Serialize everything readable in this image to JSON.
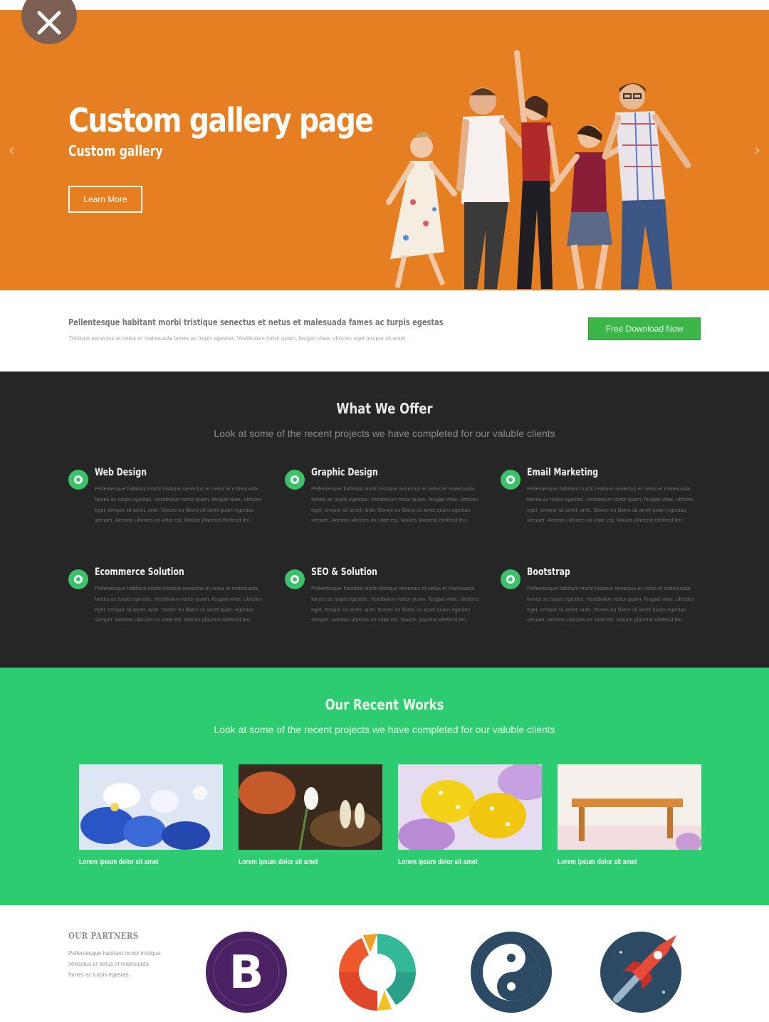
{
  "colors": {
    "hero_bg": "#e57f22",
    "offer_bg": "#262626",
    "works_bg": "#2ecc71",
    "cta_button": "#3cb54a",
    "icon_green": "#3cc26a"
  },
  "overlay": {
    "close_icon": "close-icon"
  },
  "hero": {
    "title": "Custom gallery page",
    "subtitle": "Custom gallery",
    "button_label": "Learn More",
    "prev_arrow": "‹",
    "next_arrow": "›"
  },
  "cta": {
    "title": "Pellentesque habitant morbi tristique senectus et netus et malesuada fames ac turpis egestas",
    "text": "Tristique senectus et netus et malesuada fames ac turpis egestas. Vestibulum tortor quam, feugiat vitae, ultricies eget tempor sit amet",
    "button_label": "Free Download Now"
  },
  "offer": {
    "title": "What We Offer",
    "subtitle": "Look at some of the recent projects we have completed for our valuble clients",
    "services": [
      {
        "title": "Web Design",
        "text": "Pellentesque habitant morbi tristique senectus et netus et malesuada fames ac turpis egestas. Vestibulum tortor quam, feugiat vitae, ultricies eget, tempor sit amet, ante. Donec eu libero sit amet quam egestas semper. Aenean ultricies mi vitae est. Mauris placerat eleifend leo."
      },
      {
        "title": "Graphic Design",
        "text": "Pellentesque habitant morbi tristique senectus et netus et malesuada fames ac turpis egestas. Vestibulum tortor quam, feugiat vitae, ultricies eget, tempor sit amet, ante. Donec eu libero sit amet quam egestas semper. Aenean ultricies mi vitae est. Mauris placerat eleifend leo."
      },
      {
        "title": "Email Marketing",
        "text": "Pellentesque habitant morbi tristique senectus et netus et malesuada fames ac turpis egestas. Vestibulum tortor quam, feugiat vitae, ultricies eget, tempor sit amet, ante. Donec eu libero sit amet quam egestas semper. Aenean ultricies mi vitae est. Mauris placerat eleifend leo."
      },
      {
        "title": "Ecommerce Solution",
        "text": "Pellentesque habitant morbi tristique senectus et netus et malesuada fames ac turpis egestas. Vestibulum tortor quam, feugiat vitae, ultricies eget, tempor sit amet, ante. Donec eu libero sit amet quam egestas semper. Aenean ultricies mi vitae est. Mauris placerat eleifend leo."
      },
      {
        "title": "SEO & Solution",
        "text": "Pellentesque habitant morbi tristique senectus et netus et malesuada fames ac turpis egestas. Vestibulum tortor quam, feugiat vitae, ultricies eget, tempor sit amet, ante. Donec eu libero sit amet quam egestas semper. Aenean ultricies mi vitae est. Mauris placerat eleifend leo."
      },
      {
        "title": "Bootstrap",
        "text": "Pellentesque habitant morbi tristique senectus et netus et malesuada fames ac turpis egestas. Vestibulum tortor quam, feugiat vitae, ultricies eget, tempor sit amet, ante. Donec eu libero sit amet quam egestas semper. Aenean ultricies mi vitae est. Mauris placerat eleifend leo."
      }
    ]
  },
  "works": {
    "title": "Our Recent Works",
    "subtitle": "Look at some of the recent projects we have completed for our valuble clients",
    "items": [
      {
        "caption": "Lorem ipsum dolor sit amet",
        "image": "blue-flowers"
      },
      {
        "caption": "Lorem ipsum dolor sit amet",
        "image": "snowdrop-flower"
      },
      {
        "caption": "Lorem ipsum dolor sit amet",
        "image": "yellow-eggs"
      },
      {
        "caption": "Lorem ipsum dolor sit amet",
        "image": "wooden-stool"
      }
    ]
  },
  "partners": {
    "title": "OUR PARTNERS",
    "text": "Pellentesque habitant morbi tristique senectus et netus et malesuada fames ac turpis egestas.",
    "logos": [
      {
        "name": "bootstrap-logo",
        "letter": "B"
      },
      {
        "name": "sync-logo"
      },
      {
        "name": "yin-yang-logo"
      },
      {
        "name": "rocket-logo"
      }
    ]
  }
}
